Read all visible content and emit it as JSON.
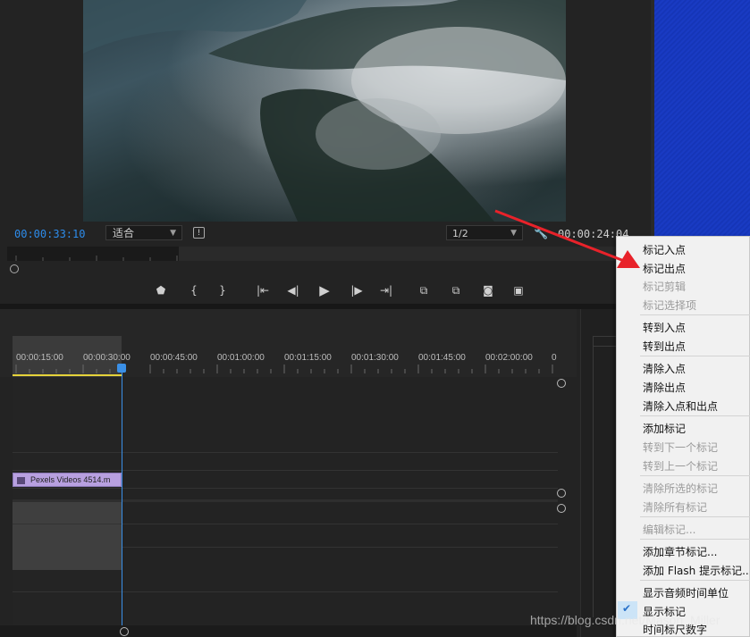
{
  "monitor": {
    "current_timecode": "00:00:33:10",
    "fit_select": "适合",
    "resolution_select": "1/2",
    "duration_timecode": "00:00:24:04"
  },
  "transport": {
    "icons": [
      "marker-icon",
      "mark-in-icon",
      "mark-out-icon",
      "go-to-in-icon",
      "step-back-icon",
      "play-icon",
      "step-forward-icon",
      "go-to-out-icon",
      "lift-icon",
      "extract-icon",
      "export-frame-icon",
      "comparison-view-icon"
    ]
  },
  "timeline": {
    "ruler_labels": [
      "00:00:15:00",
      "00:00:30:00",
      "00:00:45:00",
      "00:01:00:00",
      "00:01:15:00",
      "00:01:30:00",
      "00:01:45:00",
      "00:02:00:00",
      "0"
    ],
    "clip_name": "Pexels Videos 4514.m"
  },
  "context_menu": {
    "items": [
      {
        "label": "标记入点",
        "enabled": true
      },
      {
        "label": "标记出点",
        "enabled": true
      },
      {
        "label": "标记剪辑",
        "enabled": false
      },
      {
        "label": "标记选择项",
        "enabled": false
      },
      {
        "label": "转到入点",
        "enabled": true
      },
      {
        "label": "转到出点",
        "enabled": true
      },
      {
        "label": "清除入点",
        "enabled": true
      },
      {
        "label": "清除出点",
        "enabled": true
      },
      {
        "label": "清除入点和出点",
        "enabled": true
      },
      {
        "label": "添加标记",
        "enabled": true
      },
      {
        "label": "转到下一个标记",
        "enabled": false
      },
      {
        "label": "转到上一个标记",
        "enabled": false
      },
      {
        "label": "清除所选的标记",
        "enabled": false
      },
      {
        "label": "清除所有标记",
        "enabled": false
      },
      {
        "label": "编辑标记...",
        "enabled": false
      },
      {
        "label": "添加章节标记...",
        "enabled": true
      },
      {
        "label": "添加 Flash 提示标记...",
        "enabled": true
      },
      {
        "label": "显示音频时间单位",
        "enabled": true
      },
      {
        "label": "显示标记",
        "enabled": true,
        "checked": true
      },
      {
        "label": "时间标尺数字",
        "enabled": true
      }
    ]
  },
  "watermark": "https://blog.csdn.net/Mason_Miller",
  "colors": {
    "accent_blue": "#2d8ceb",
    "clip": "#b8a0e0",
    "in_out_bar": "#e5d23a",
    "annotation_arrow": "#e8222a"
  }
}
